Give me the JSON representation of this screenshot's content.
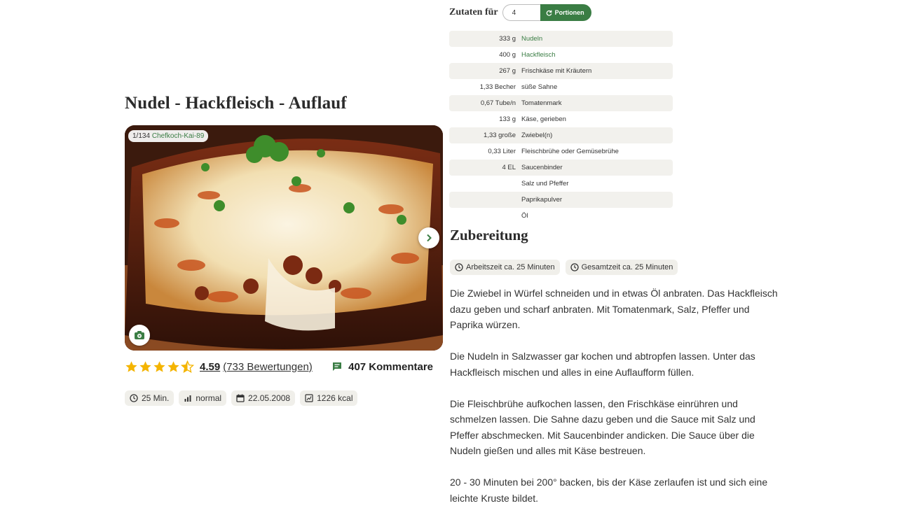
{
  "recipe": {
    "title": "Nudel - Hackfleisch - Auflauf",
    "photo": {
      "counter": "1/134",
      "author": "Chefkoch-Kai-89"
    },
    "rating": {
      "stars": 4.5,
      "value": "4.59",
      "count": "(733 Bewertungen)"
    },
    "comments": "407 Kommentare",
    "meta": {
      "time": "25 Min.",
      "difficulty": "normal",
      "date": "22.05.2008",
      "calories": "1226 kcal"
    }
  },
  "servings": {
    "label": "Zutaten für",
    "value": "4",
    "button": "Portionen"
  },
  "ingredients": [
    {
      "amount": "333 g",
      "name": "Nudeln",
      "link": true
    },
    {
      "amount": "400 g",
      "name": "Hackfleisch",
      "link": true
    },
    {
      "amount": "267 g",
      "name": "Frischkäse mit Kräutern",
      "link": false
    },
    {
      "amount": "1,33 Becher",
      "name": "süße Sahne",
      "link": false
    },
    {
      "amount": "0,67 Tube/n",
      "name": "Tomatenmark",
      "link": false
    },
    {
      "amount": "133 g",
      "name": "Käse, gerieben",
      "link": false
    },
    {
      "amount": "1,33 große",
      "name": "Zwiebel(n)",
      "link": false
    },
    {
      "amount": "0,33 Liter",
      "name": "Fleischbrühe oder Gemüsebrühe",
      "link": false
    },
    {
      "amount": "4 EL",
      "name": "Saucenbinder",
      "link": false
    },
    {
      "amount": "",
      "name": "Salz und Pfeffer",
      "link": false
    },
    {
      "amount": "",
      "name": "Paprikapulver",
      "link": false
    },
    {
      "amount": "",
      "name": "Öl",
      "link": false
    }
  ],
  "preparation": {
    "title": "Zubereitung",
    "work_time": "Arbeitszeit ca. 25 Minuten",
    "total_time": "Gesamtzeit ca. 25 Minuten",
    "steps": [
      "Die Zwiebel in Würfel schneiden und in etwas Öl anbraten. Das Hackfleisch dazu geben und scharf anbraten. Mit Tomatenmark, Salz, Pfeffer und Paprika würzen.",
      "Die Nudeln in Salzwasser gar kochen und abtropfen lassen. Unter das Hackfleisch mischen und alles in eine Auflaufform füllen.",
      "Die Fleischbrühe aufkochen lassen, den Frischkäse einrühren und schmelzen lassen. Die Sahne dazu geben und die Sauce mit Salz und Pfeffer abschmecken. Mit Saucenbinder andicken. Die Sauce über die Nudeln gießen und alles mit Käse bestreuen.",
      "20 - 30 Minuten bei 200° backen, bis der Käse zerlaufen ist und sich eine leichte Kruste bildet."
    ]
  },
  "icons": {
    "star": "star-icon",
    "comment": "comment-icon",
    "clock": "clock-icon",
    "difficulty": "bar-chart-icon",
    "calendar": "calendar-icon",
    "calories": "calories-icon",
    "camera": "camera-add-icon",
    "next": "chevron-right-icon",
    "refresh": "refresh-icon"
  },
  "colors": {
    "accent": "#3a7d44",
    "star": "#f4b400",
    "chip": "#f0efea"
  }
}
